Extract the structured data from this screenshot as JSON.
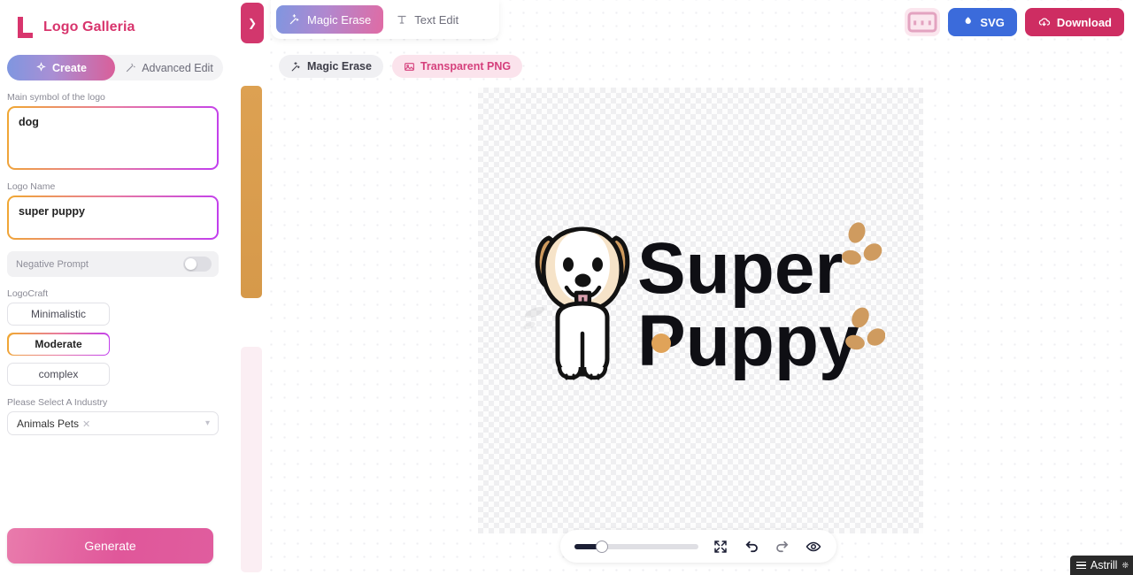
{
  "app": {
    "brand_name": "Logo Galleria",
    "brand_icon": "logo-l-mark"
  },
  "sidebar": {
    "segments": [
      {
        "label": "Create",
        "icon": "sparkle-icon",
        "active": true
      },
      {
        "label": "Advanced Edit",
        "icon": "magic-wand-icon",
        "active": false
      }
    ],
    "fields": [
      {
        "label": "Main symbol of the logo",
        "value": "dog",
        "placeholder": ""
      },
      {
        "label": "Logo Name",
        "value": "super puppy",
        "placeholder": ""
      }
    ],
    "negative_prompt": {
      "label": "Negative Prompt",
      "enabled": false
    },
    "logocraft": {
      "label": "LogoCraft",
      "options": [
        {
          "label": "Minimalistic",
          "selected": false
        },
        {
          "label": "Moderate",
          "selected": true
        },
        {
          "label": "complex",
          "selected": false
        }
      ]
    },
    "industry": {
      "label": "Please Select A Industry",
      "selected": "Animals Pets",
      "remove_icon": "close-x-icon",
      "chevron_icon": "chevron-down-icon"
    },
    "generate_label": "Generate"
  },
  "collapse_toggle": {
    "icon": "chevron-right-icon"
  },
  "main": {
    "tabs": [
      {
        "label": "Magic Erase",
        "icon": "magic-wand-sparkle-icon",
        "active": true
      },
      {
        "label": "Text Edit",
        "icon": "text-edit-icon",
        "active": false
      }
    ],
    "chips": [
      {
        "label": "Magic Erase",
        "icon": "wand-icon",
        "style": "grey"
      },
      {
        "label": "Transparent PNG",
        "icon": "image-icon",
        "style": "pink"
      }
    ],
    "top_right": [
      {
        "name": "card-view-button",
        "icon": "card-icon",
        "label": ""
      },
      {
        "name": "svg-button",
        "icon": "svg-icon",
        "label": "SVG"
      },
      {
        "name": "download-button",
        "icon": "cloud-download-icon",
        "label": "Download"
      }
    ]
  },
  "artwork": {
    "title_line1": "Super",
    "title_line2": "Puppy",
    "mascot": "dog-mascot",
    "colors": {
      "ear": "#cf9b5f",
      "face": "#f6e3c8",
      "body": "#ffffff",
      "outline": "#121212",
      "tongue": "#d9a0ae",
      "paw": "#d9a059",
      "text": "#0f0f14"
    }
  },
  "bottom_toolbar": {
    "slider": {
      "value": 22,
      "min": 0,
      "max": 100
    },
    "buttons": [
      {
        "name": "fit-screen-button",
        "icon": "expand-arrows-icon"
      },
      {
        "name": "undo-button",
        "icon": "undo-arrow-icon"
      },
      {
        "name": "redo-button",
        "icon": "redo-arrow-icon"
      },
      {
        "name": "preview-button",
        "icon": "eye-icon"
      }
    ]
  },
  "watermark": {
    "label": "Astrill",
    "icon": "hamburger-icon"
  },
  "theme": {
    "brand_pink": "#d8356d",
    "accent_blue": "#3b6bdb",
    "crimson": "#ce2d62",
    "gradient_start": "#f0a830",
    "gradient_end": "#c13df0"
  }
}
